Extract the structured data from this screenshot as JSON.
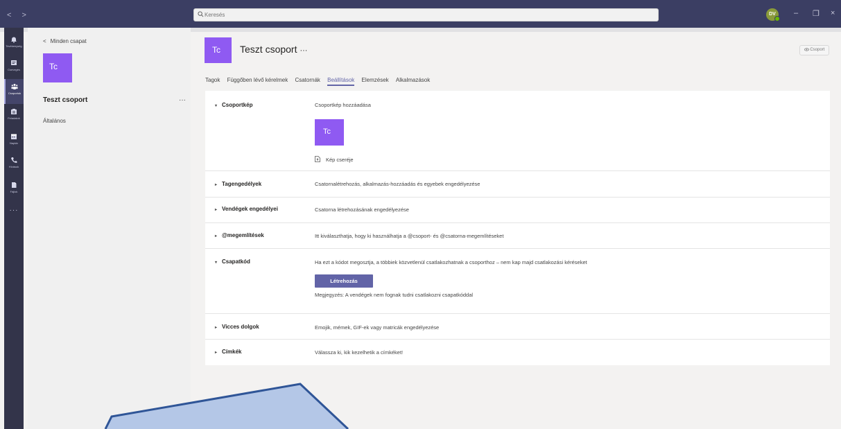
{
  "window": {
    "nav_arrows": "< >",
    "search_placeholder": "Keresés",
    "avatar_initials": "DV",
    "minimize": "–",
    "maximize": "❐",
    "close": "×"
  },
  "rail": {
    "items": [
      {
        "label": "Tevékenység",
        "icon": "bell-icon"
      },
      {
        "label": "Csevegés",
        "icon": "chat-icon"
      },
      {
        "label": "Csoportok",
        "icon": "teams-icon",
        "active": true
      },
      {
        "label": "Feladatok",
        "icon": "assignments-icon"
      },
      {
        "label": "Naptár",
        "icon": "calendar-icon"
      },
      {
        "label": "Hívások",
        "icon": "phone-icon"
      },
      {
        "label": "Fájlok",
        "icon": "files-icon"
      }
    ],
    "more": "···"
  },
  "team_panel": {
    "back": "Minden csapat",
    "avatar": "Tc",
    "team_name": "Teszt csoport",
    "more": "···",
    "channel": "Általános"
  },
  "header": {
    "avatar": "Tc",
    "title": "Teszt csoport",
    "title_more": "···",
    "team_button": "Csoport"
  },
  "tabs": [
    {
      "label": "Tagok"
    },
    {
      "label": "Függőben lévő kérelmek"
    },
    {
      "label": "Csatornák"
    },
    {
      "label": "Beállítások",
      "active": true
    },
    {
      "label": "Elemzések"
    },
    {
      "label": "Alkalmazások"
    }
  ],
  "settings": {
    "team_picture": {
      "header": "Csoportkép",
      "desc": "Csoportkép hozzáadása",
      "avatar": "Tc",
      "change": "Kép cseréje"
    },
    "member_permissions": {
      "header": "Tagengedélyek",
      "desc": "Csatornalétrehozás, alkalmazás-hozzáadás és egyebek engedélyezése"
    },
    "guest_permissions": {
      "header": "Vendégek engedélyei",
      "desc": "Csatorna létrehozásának engedélyezése"
    },
    "mentions": {
      "header": "@megemlítések",
      "desc": "Itt kiválaszthatja, hogy ki használhatja a @csoport- és @csatorna-megemlítéseket"
    },
    "team_code": {
      "header": "Csapatkód",
      "desc": "Ha ezt a kódot megosztja, a többiek közvetlenül csatlakozhatnak a csoporthoz – nem kap majd csatlakozási kéréseket",
      "create": "Létrehozás",
      "note": "Megjegyzés: A vendégek nem fognak tudni csatlakozni csapatkóddal"
    },
    "fun_stuff": {
      "header": "Vicces dolgok",
      "desc": "Emojik, mémek, GIF-ek vagy matricák engedélyezése"
    },
    "tags": {
      "header": "Címkék",
      "desc": "Válassza ki, kik kezelhetik a címkéket!"
    }
  },
  "colors": {
    "accent": "#6264a7",
    "team_avatar": "#8f5af2",
    "titlebar": "#3b3e63",
    "overlay_fill": "#b4c7e7",
    "overlay_stroke": "#2f5597"
  }
}
